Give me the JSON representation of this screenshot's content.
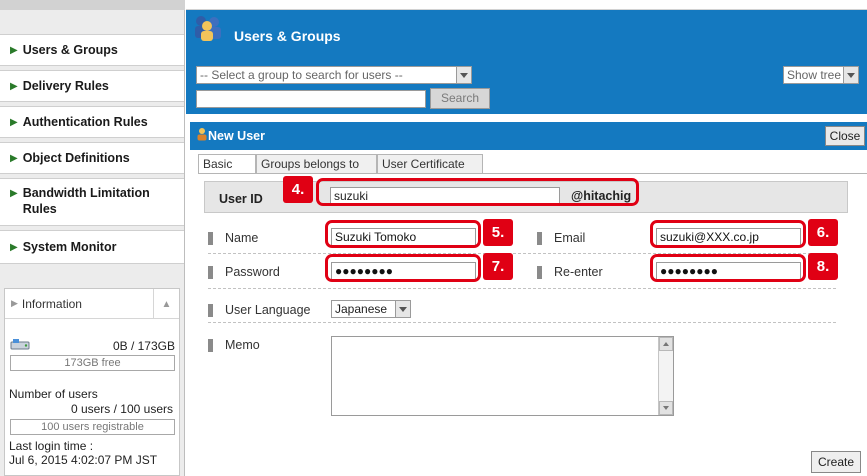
{
  "sidebar": {
    "nav": [
      {
        "label": "Users & Groups"
      },
      {
        "label": "Delivery Rules"
      },
      {
        "label": "Authentication Rules"
      },
      {
        "label": "Object Definitions"
      },
      {
        "label": "Bandwidth Limitation",
        "label2": "Rules"
      },
      {
        "label": "System Monitor"
      }
    ],
    "info": {
      "title": "Information",
      "disk_usage": "0B / 173GB",
      "disk_free": "173GB free",
      "users_label": "Number of users",
      "users_value": "0 users / 100 users",
      "users_registrable": "100 users registrable",
      "last_login_label": "Last login time :",
      "last_login_value": "Jul 6, 2015 4:02:07 PM JST"
    }
  },
  "header": {
    "title": "Users & Groups",
    "group_select": "-- Select a group to search for users --",
    "search_label": "Search",
    "show_tree": "Show tree"
  },
  "dialog": {
    "title": "New User",
    "close_label": "Close",
    "tabs": [
      {
        "label": "Basic"
      },
      {
        "label": "Groups belongs to"
      },
      {
        "label": "User Certificate"
      }
    ],
    "user_id_label": "User ID",
    "user_id_value": "suzuki",
    "domain": "@hitachig",
    "name_label": "Name",
    "name_value": "Suzuki Tomoko",
    "email_label": "Email",
    "email_value": "suzuki@XXX.co.jp",
    "password_label": "Password",
    "password_value": "●●●●●●●●",
    "reenter_label": "Re-enter",
    "reenter_value": "●●●●●●●●",
    "language_label": "User Language",
    "language_value": "Japanese",
    "memo_label": "Memo",
    "create_label": "Create"
  },
  "callouts": [
    "4.",
    "5.",
    "6.",
    "7.",
    "8."
  ],
  "colors": {
    "header_blue": "#1479c0",
    "callout_red": "#e00014"
  }
}
